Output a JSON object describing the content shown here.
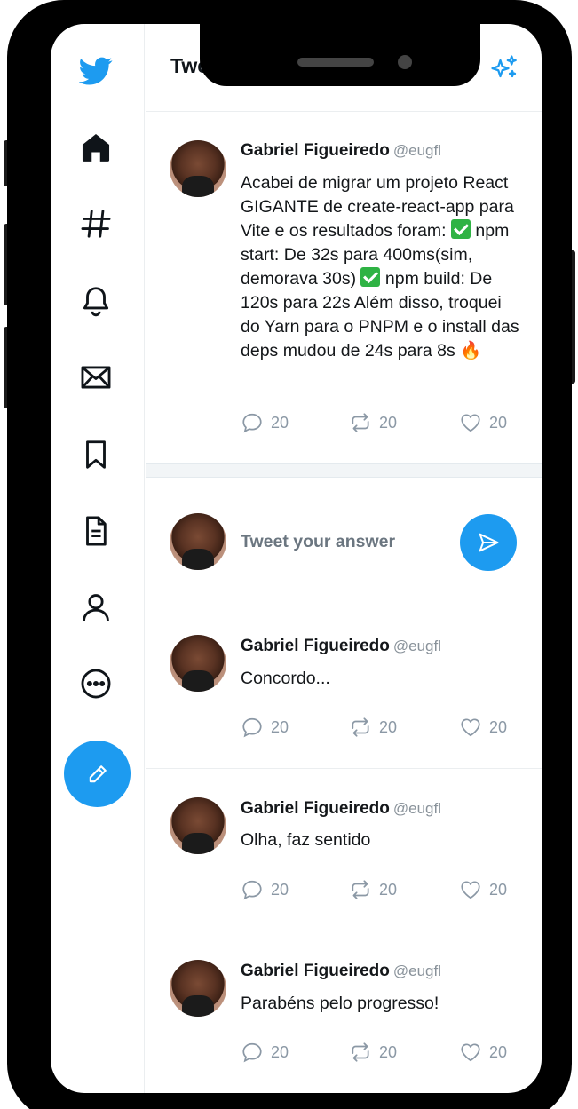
{
  "header": {
    "title": "Tweet"
  },
  "main_tweet": {
    "author_name": "Gabriel Figueiredo",
    "author_handle": "@eugfl",
    "text_parts": [
      "Acabei de migrar um projeto React GIGANTE de create-react-app para Vite e os resultados foram: ",
      " npm start: De 32s para 400ms(sim, demorava 30s) ",
      " npm build: De 120s para 22s Além disso, troquei do Yarn para o PNPM e o install das deps mudou de 24s para 8s "
    ],
    "emoji_check": "check-mark-icon",
    "emoji_fire": "🔥",
    "replies": "20",
    "retweets": "20",
    "likes": "20"
  },
  "composer": {
    "placeholder": "Tweet your answer"
  },
  "replies": [
    {
      "author_name": "Gabriel Figueiredo",
      "author_handle": "@eugfl",
      "text": "Concordo...",
      "replies": "20",
      "retweets": "20",
      "likes": "20"
    },
    {
      "author_name": "Gabriel Figueiredo",
      "author_handle": "@eugfl",
      "text": "Olha, faz sentido",
      "replies": "20",
      "retweets": "20",
      "likes": "20"
    },
    {
      "author_name": "Gabriel Figueiredo",
      "author_handle": "@eugfl",
      "text": "Parabéns pelo progresso!",
      "replies": "20",
      "retweets": "20",
      "likes": "20"
    }
  ],
  "sidebar_icons": [
    "twitter-logo-icon",
    "home-icon",
    "hashtag-icon",
    "bell-icon",
    "envelope-icon",
    "bookmark-icon",
    "document-icon",
    "user-icon",
    "more-icon",
    "compose-icon"
  ],
  "colors": {
    "accent": "#1d9bf0",
    "text": "#14171a",
    "muted": "#89929a"
  }
}
